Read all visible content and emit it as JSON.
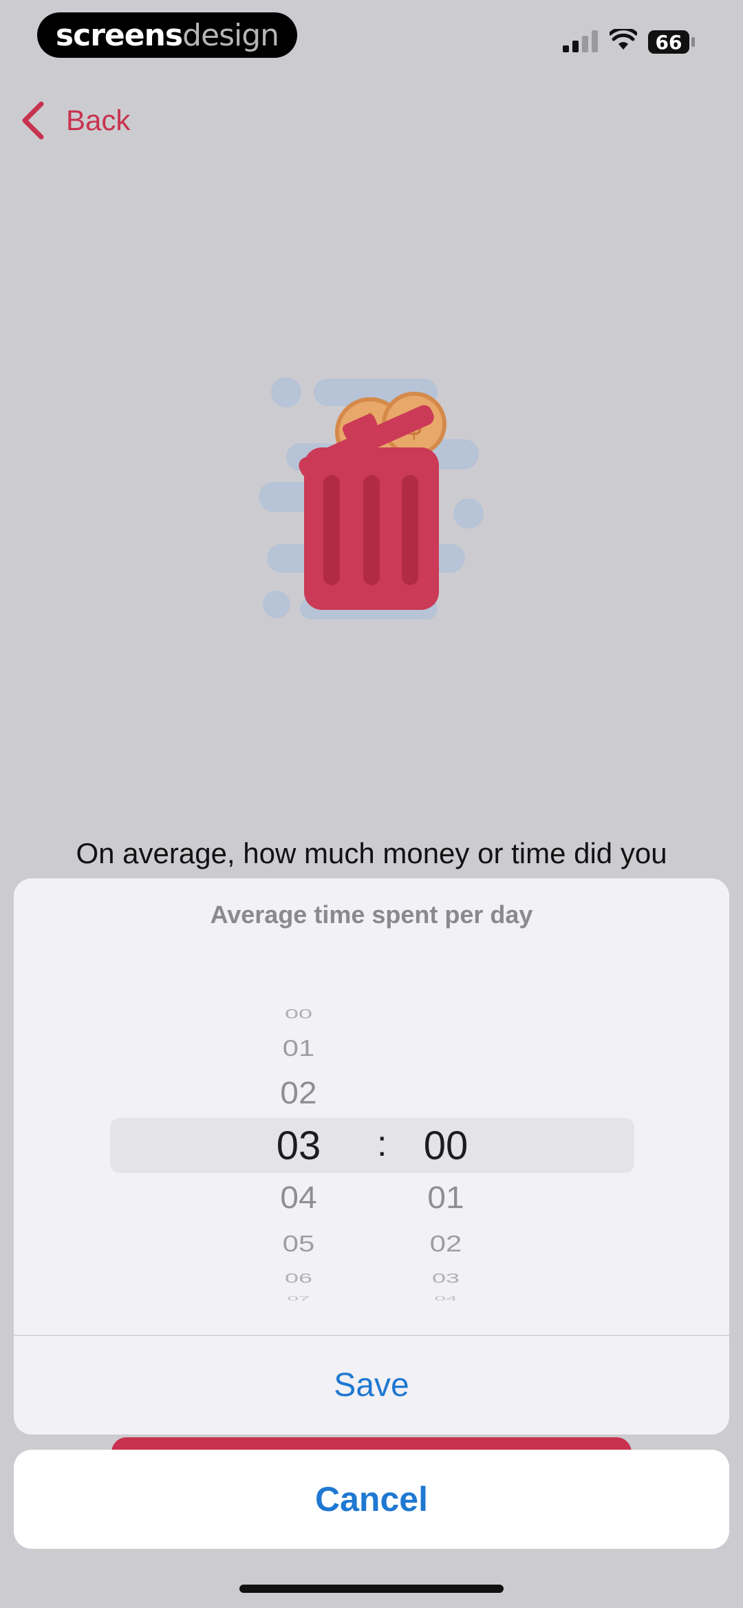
{
  "watermark": {
    "part1": "screens",
    "part2": "design"
  },
  "status_bar": {
    "battery": "66"
  },
  "nav": {
    "back_label": "Back"
  },
  "question": "On average, how much money or time did you",
  "picker": {
    "title": "Average time spent per day",
    "separator": ":",
    "hours": [
      "00",
      "01",
      "02",
      "03",
      "04",
      "05",
      "06",
      "07"
    ],
    "minutes": [
      "00",
      "01",
      "02",
      "03",
      "04"
    ],
    "selected_hour": "03",
    "selected_minute": "00"
  },
  "actions": {
    "save_label": "Save",
    "cancel_label": "Cancel"
  },
  "colors": {
    "accent_red": "#c8324e",
    "action_blue": "#1f78d1"
  }
}
